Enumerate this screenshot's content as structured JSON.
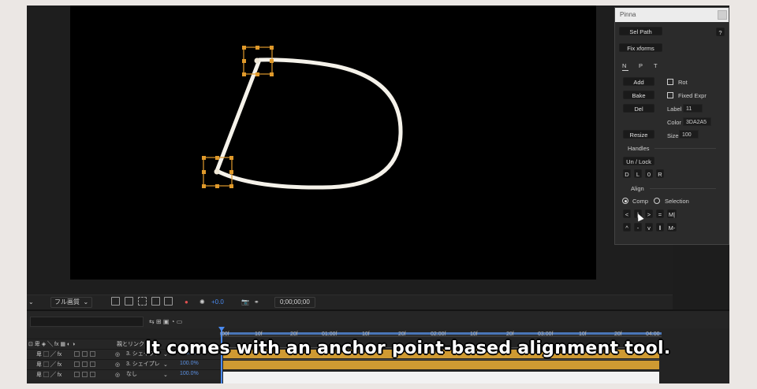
{
  "colors": {
    "path_stroke": "#f5f2ea",
    "handle_orange": "#e09a2b",
    "layer_bar": "#cf9a32",
    "accent_blue": "#4a8af0"
  },
  "comp_toolbar": {
    "quality_dropdown": "フル画質",
    "exposure_value": "+0.0",
    "timecode": "0;00;00;00",
    "icons": [
      "region-icon",
      "transparency-grid-icon",
      "mask-icon",
      "guides-icon",
      "view-icon",
      "color-icon",
      "exposure-reset-icon",
      "snapshot-icon",
      "show-snapshot-icon"
    ]
  },
  "timeline": {
    "ruler_ticks": [
      ":00f",
      "10f",
      "20f",
      "01:00f",
      "10f",
      "20f",
      "02:00f",
      "10f",
      "20f",
      "03:00f",
      "10f",
      "20f",
      "04:00"
    ],
    "parent_column_header": "親とリンク",
    "layers": [
      {
        "parent": "3. シェイプレ",
        "value": "100.0%"
      },
      {
        "parent": "3. シェイプレ",
        "value": "100.0%"
      },
      {
        "parent": "なし",
        "value": "100.0%"
      }
    ]
  },
  "subtitle": "It comes with an anchor point-based alignment tool.",
  "pinna": {
    "title": "Pinna",
    "sel_path": "Sel Path",
    "help": "?",
    "fix_xforms": "Fix xforms",
    "tabs": [
      "N",
      "P",
      "T"
    ],
    "add": "Add",
    "bake": "Bake",
    "del": "Del",
    "resize": "Resize",
    "rot_label": "Rot",
    "fixed_expr_label": "Fixed Expr",
    "label_label": "Label",
    "label_value": "11",
    "color_label": "Color",
    "color_value": "3DA2A5",
    "size_label": "Size",
    "size_value": "100",
    "handles_section": "Handles",
    "unlock": "Un / Lock",
    "handle_buttons": [
      "D",
      "L",
      "0",
      "R"
    ],
    "align_section": "Align",
    "comp_option": "Comp",
    "selection_option": "Selection",
    "align_row1": [
      "<",
      "|",
      ">",
      "=",
      "M|"
    ],
    "align_row2": [
      "^",
      "-",
      "v",
      "‖",
      "M-"
    ]
  }
}
